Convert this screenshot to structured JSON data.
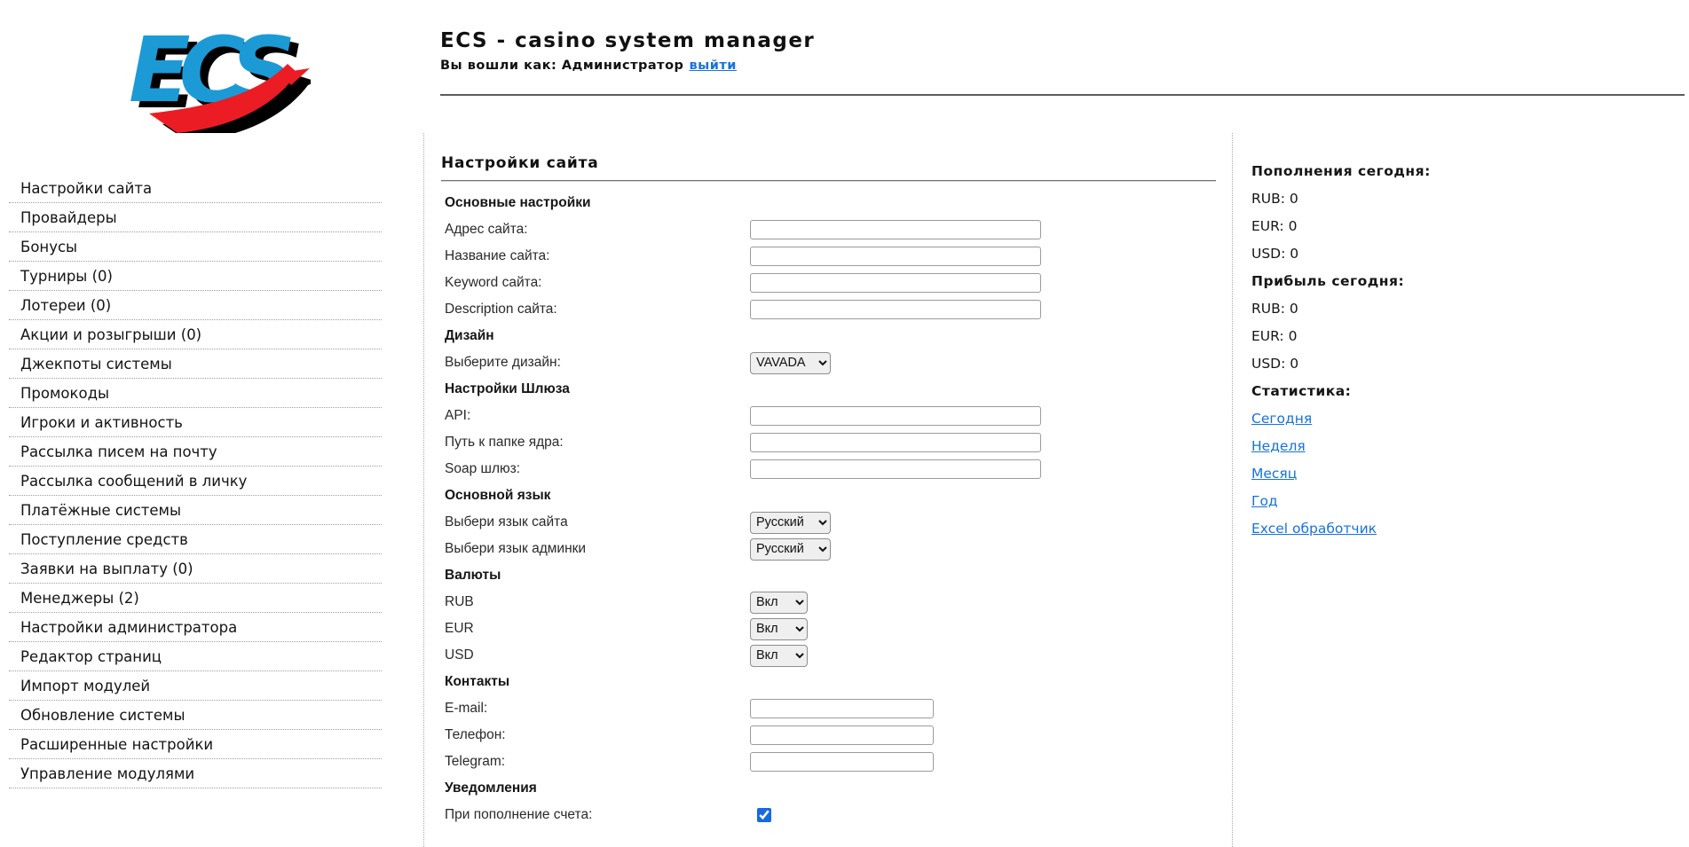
{
  "header": {
    "logo_text": "ECS",
    "title": "ECS - casino system manager",
    "login_prefix": "Вы вошли как: Администратор",
    "logout_label": "выйти"
  },
  "sidebar": {
    "items": [
      {
        "label": "Настройки сайта"
      },
      {
        "label": "Провайдеры"
      },
      {
        "label": "Бонусы"
      },
      {
        "label": "Турниры (0)"
      },
      {
        "label": "Лотереи (0)"
      },
      {
        "label": "Акции и розыгрыши (0)"
      },
      {
        "label": "Джекпоты системы"
      },
      {
        "label": "Промокоды"
      },
      {
        "label": "Игроки и активность"
      },
      {
        "label": "Рассылка писем на почту"
      },
      {
        "label": "Рассылка сообщений в личку"
      },
      {
        "label": "Платёжные системы"
      },
      {
        "label": "Поступление средств"
      },
      {
        "label": "Заявки на выплату (0)"
      },
      {
        "label": "Менеджеры (2)"
      },
      {
        "label": "Настройки администратора"
      },
      {
        "label": "Редактор страниц"
      },
      {
        "label": "Импорт модулей"
      },
      {
        "label": "Обновление системы"
      },
      {
        "label": "Расширенные настройки"
      },
      {
        "label": "Управление модулями"
      }
    ]
  },
  "main": {
    "title": "Настройки сайта",
    "rows": [
      {
        "type": "section",
        "label": "Основные настройки"
      },
      {
        "type": "input",
        "label": "Адрес сайта:",
        "value": "",
        "size": "wide",
        "name": "site-address-input"
      },
      {
        "type": "input",
        "label": "Название сайта:",
        "value": "",
        "size": "wide",
        "name": "site-name-input"
      },
      {
        "type": "input",
        "label": "Keyword сайта:",
        "value": "",
        "size": "wide",
        "name": "site-keyword-input"
      },
      {
        "type": "input",
        "label": "Description сайта:",
        "value": "",
        "size": "wide",
        "name": "site-description-input"
      },
      {
        "type": "section",
        "label": "Дизайн"
      },
      {
        "type": "select",
        "label": "Выберите дизайн:",
        "value": "VAVADA",
        "size": "medium",
        "name": "design-select"
      },
      {
        "type": "section",
        "label": "Настройки Шлюза"
      },
      {
        "type": "input",
        "label": "API:",
        "value": "",
        "size": "wide",
        "name": "api-input"
      },
      {
        "type": "input",
        "label": "Путь к папке ядра:",
        "value": "",
        "size": "wide",
        "name": "core-folder-path-input"
      },
      {
        "type": "input",
        "label": "Soap шлюз:",
        "value": "",
        "size": "wide",
        "name": "soap-gateway-input"
      },
      {
        "type": "section",
        "label": "Основной язык"
      },
      {
        "type": "select",
        "label": "Выбери язык сайта",
        "value": "Русский",
        "size": "medium",
        "name": "site-language-select"
      },
      {
        "type": "select",
        "label": "Выбери язык админки",
        "value": "Русский",
        "size": "medium",
        "name": "admin-language-select"
      },
      {
        "type": "section",
        "label": "Валюты"
      },
      {
        "type": "select",
        "label": "RUB",
        "value": "Вкл",
        "size": "small",
        "name": "rub-currency-select",
        "rowclass": "r-rub"
      },
      {
        "type": "select",
        "label": "EUR",
        "value": "Вкл",
        "size": "small",
        "name": "eur-currency-select",
        "rowclass": "r-eur"
      },
      {
        "type": "select",
        "label": "USD",
        "value": "Вкл",
        "size": "small",
        "name": "usd-currency-select",
        "rowclass": "r-usd"
      },
      {
        "type": "section",
        "label": "Контакты"
      },
      {
        "type": "input",
        "label": "E-mail:",
        "value": "",
        "size": "narrow",
        "name": "email-input"
      },
      {
        "type": "input",
        "label": "Телефон:",
        "value": "",
        "size": "narrow",
        "name": "phone-input"
      },
      {
        "type": "input",
        "label": "Telegram:",
        "value": "",
        "size": "narrow",
        "name": "telegram-input"
      },
      {
        "type": "section",
        "label": "Уведомления"
      },
      {
        "type": "checkbox",
        "label": "При пополнение счета:",
        "checked": true,
        "name": "deposit-notification-checkbox"
      }
    ]
  },
  "stats": {
    "lines": [
      {
        "type": "header",
        "label": "Пополнения сегодня:"
      },
      {
        "type": "value",
        "label": "RUB: 0"
      },
      {
        "type": "value",
        "label": "EUR: 0"
      },
      {
        "type": "value",
        "label": "USD: 0"
      },
      {
        "type": "header",
        "label": "Прибыль сегодня:"
      },
      {
        "type": "value",
        "label": "RUB: 0"
      },
      {
        "type": "value",
        "label": "EUR: 0"
      },
      {
        "type": "value",
        "label": "USD: 0"
      },
      {
        "type": "header",
        "label": "Статистика:"
      },
      {
        "type": "link",
        "label": "Сегодня"
      },
      {
        "type": "link",
        "label": "Неделя"
      },
      {
        "type": "link",
        "label": "Месяц"
      },
      {
        "type": "link",
        "label": "Год"
      },
      {
        "type": "link",
        "label": "Excel обработчик"
      }
    ]
  },
  "colors": {
    "logo_blue": "#1c9ad6",
    "logo_red": "#ec1c24",
    "link_blue": "#1573db",
    "checkbox_accent": "#1668e3"
  }
}
